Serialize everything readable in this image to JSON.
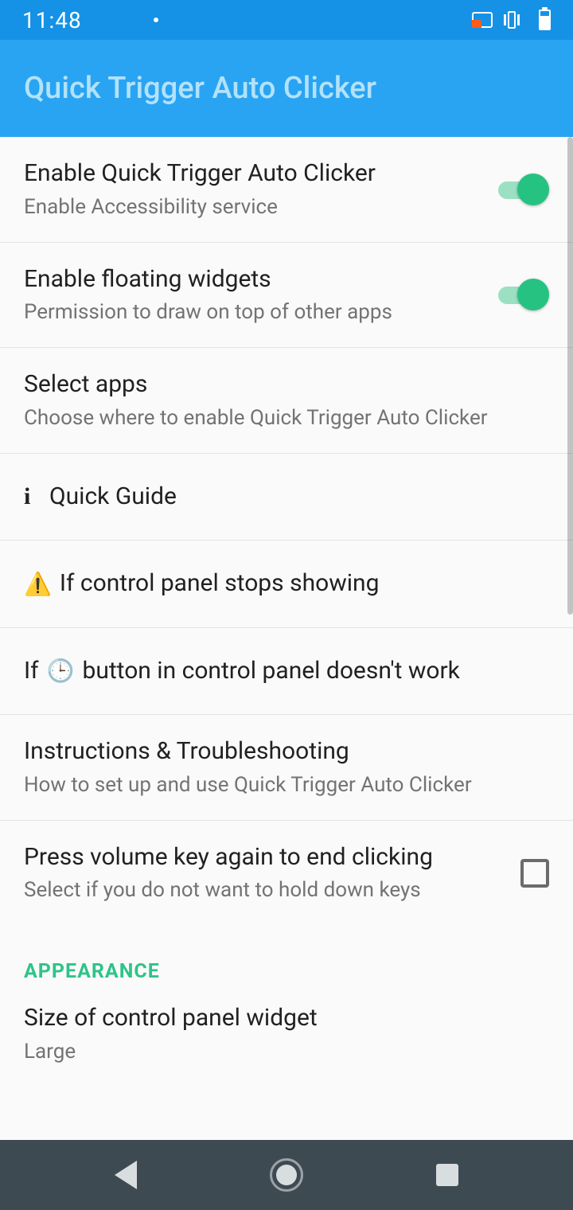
{
  "status": {
    "time": "11:48"
  },
  "app": {
    "title": "Quick Trigger Auto Clicker"
  },
  "settings": {
    "enable": {
      "title": "Enable Quick Trigger Auto Clicker",
      "sub": "Enable Accessibility service"
    },
    "floating": {
      "title": "Enable floating widgets",
      "sub": "Permission to draw on top of other apps"
    },
    "selectApps": {
      "title": "Select apps",
      "sub": "Choose where to enable Quick Trigger Auto Clicker"
    },
    "quickGuide": {
      "title": "Quick Guide"
    },
    "panelStops": {
      "title": "If control panel stops showing"
    },
    "clockButton": {
      "prefix": "If ",
      "suffix": " button in control panel doesn't work"
    },
    "instructions": {
      "title": "Instructions & Troubleshooting",
      "sub": "How to set up and use Quick Trigger Auto Clicker"
    },
    "volumeKey": {
      "title": "Press volume key again to end clicking",
      "sub": "Select if you do not want to hold down keys"
    }
  },
  "section": {
    "appearance": "APPEARANCE"
  },
  "appearance": {
    "size": {
      "title": "Size of control panel widget",
      "value": "Large"
    }
  }
}
